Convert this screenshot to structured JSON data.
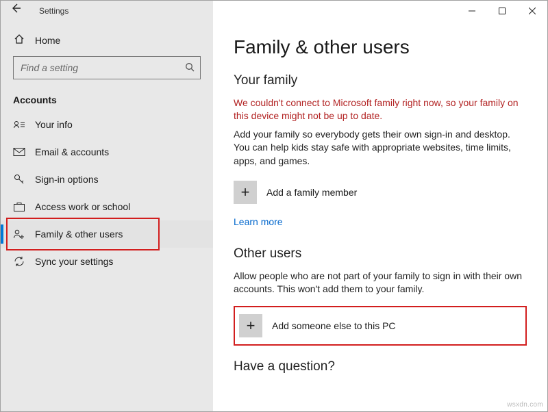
{
  "window": {
    "title": "Settings"
  },
  "sidebar": {
    "home": "Home",
    "search_placeholder": "Find a setting",
    "section": "Accounts",
    "items": [
      {
        "label": "Your info"
      },
      {
        "label": "Email & accounts"
      },
      {
        "label": "Sign-in options"
      },
      {
        "label": "Access work or school"
      },
      {
        "label": "Family & other users"
      },
      {
        "label": "Sync your settings"
      }
    ]
  },
  "main": {
    "title": "Family & other users",
    "family": {
      "heading": "Your family",
      "error": "We couldn't connect to Microsoft family right now, so your family on this device might not be up to date.",
      "description": "Add your family so everybody gets their own sign-in and desktop. You can help kids stay safe with appropriate websites, time limits, apps, and games.",
      "add_label": "Add a family member",
      "learn_more": "Learn more"
    },
    "other": {
      "heading": "Other users",
      "description": "Allow people who are not part of your family to sign in with their own accounts. This won't add them to your family.",
      "add_label": "Add someone else to this PC"
    },
    "question": "Have a question?"
  },
  "watermark": "wsxdn.com"
}
